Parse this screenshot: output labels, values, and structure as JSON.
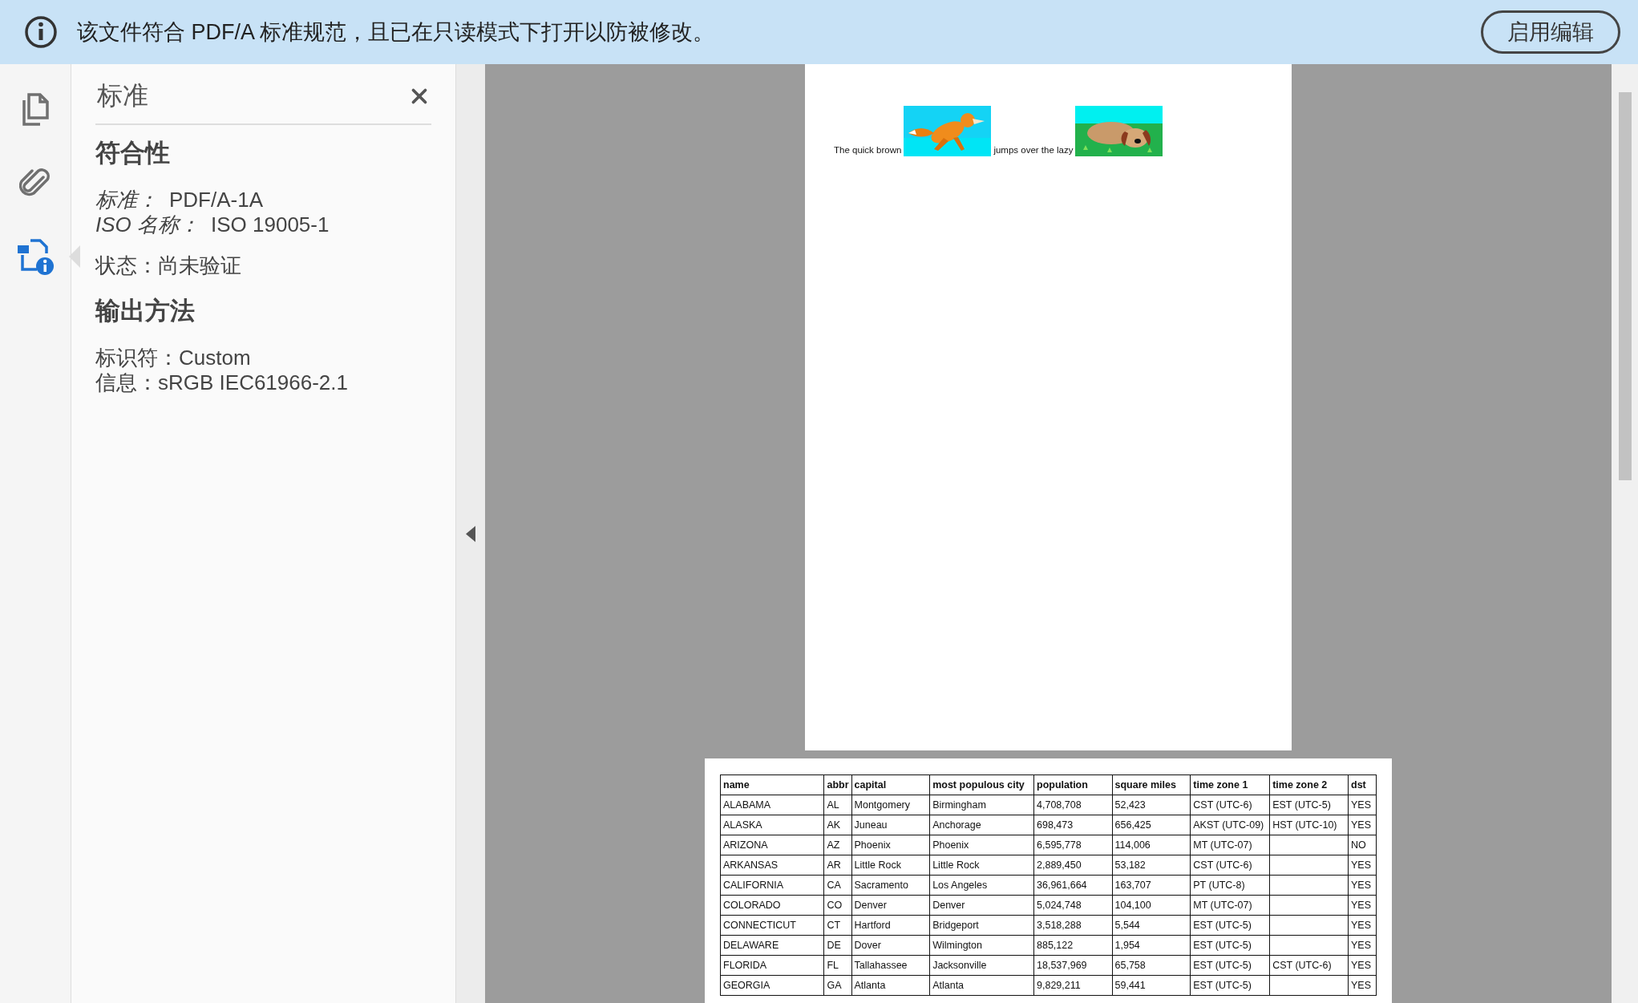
{
  "banner": {
    "message": "该文件符合 PDF/A 标准规范，且已在只读模式下打开以防被修改。",
    "button": "启用编辑"
  },
  "rail": [
    {
      "kind": "pages",
      "selected": false
    },
    {
      "kind": "attachments",
      "selected": false
    },
    {
      "kind": "standards",
      "selected": true
    }
  ],
  "panel": {
    "title": "标准",
    "sections": [
      {
        "heading": "符合性",
        "groups": [
          [
            {
              "label": "标准：",
              "value": "PDF/A-1A",
              "italic_label": true
            },
            {
              "label": "ISO 名称：",
              "value": "ISO 19005-1",
              "italic_label": true
            }
          ],
          [
            {
              "label": "状态：",
              "value": "尚未验证",
              "italic_label": false
            }
          ]
        ]
      },
      {
        "heading": "输出方法",
        "groups": [
          [
            {
              "label": "标识符：",
              "value": "Custom",
              "italic_label": false
            },
            {
              "label": "信息：",
              "value": "sRGB IEC61966-2.1",
              "italic_label": false
            }
          ]
        ]
      }
    ]
  },
  "document": {
    "line": [
      {
        "kind": "text",
        "text": "The quick brown"
      },
      {
        "kind": "picture"
      },
      {
        "kind": "text",
        "text": "jumps over the lazy"
      },
      {
        "kind": "picture"
      }
    ],
    "table": {
      "columns": [
        "name",
        "abbr",
        "capital",
        "most populous city",
        "population",
        "square miles",
        "time zone 1",
        "time zone 2",
        "dst"
      ],
      "rows": [
        [
          "ALABAMA",
          "AL",
          "Montgomery",
          "Birmingham",
          "4,708,708",
          "52,423",
          "CST (UTC-6)",
          "EST (UTC-5)",
          "YES"
        ],
        [
          "ALASKA",
          "AK",
          "Juneau",
          "Anchorage",
          "698,473",
          "656,425",
          "AKST (UTC-09)",
          "HST (UTC-10)",
          "YES"
        ],
        [
          "ARIZONA",
          "AZ",
          "Phoenix",
          "Phoenix",
          "6,595,778",
          "114,006",
          "MT (UTC-07)",
          "",
          "NO"
        ],
        [
          "ARKANSAS",
          "AR",
          "Little Rock",
          "Little Rock",
          "2,889,450",
          "53,182",
          "CST (UTC-6)",
          "",
          "YES"
        ],
        [
          "CALIFORNIA",
          "CA",
          "Sacramento",
          "Los Angeles",
          "36,961,664",
          "163,707",
          "PT (UTC-8)",
          "",
          "YES"
        ],
        [
          "COLORADO",
          "CO",
          "Denver",
          "Denver",
          "5,024,748",
          "104,100",
          "MT (UTC-07)",
          "",
          "YES"
        ],
        [
          "CONNECTICUT",
          "CT",
          "Hartford",
          "Bridgeport",
          "3,518,288",
          "5,544",
          "EST (UTC-5)",
          "",
          "YES"
        ],
        [
          "DELAWARE",
          "DE",
          "Dover",
          "Wilmington",
          "885,122",
          "1,954",
          "EST (UTC-5)",
          "",
          "YES"
        ],
        [
          "FLORIDA",
          "FL",
          "Tallahassee",
          "Jacksonville",
          "18,537,969",
          "65,758",
          "EST (UTC-5)",
          "CST (UTC-6)",
          "YES"
        ],
        [
          "GEORGIA",
          "GA",
          "Atlanta",
          "Atlanta",
          "9,829,211",
          "59,441",
          "EST (UTC-5)",
          "",
          "YES"
        ]
      ]
    }
  }
}
